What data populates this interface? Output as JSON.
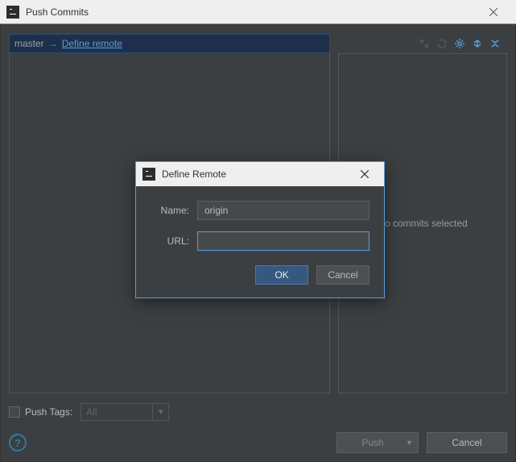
{
  "window": {
    "title": "Push Commits"
  },
  "branch": {
    "local": "master",
    "arrow": "→",
    "remote_link": "Define remote"
  },
  "right": {
    "placeholder": "No commits selected"
  },
  "pushTags": {
    "label": "Push Tags:",
    "comboValue": "All"
  },
  "buttons": {
    "push": "Push",
    "cancel": "Cancel",
    "helpGlyph": "?"
  },
  "modal": {
    "title": "Define Remote",
    "fields": {
      "nameLabel": "Name:",
      "nameValue": "origin",
      "urlLabel": "URL:",
      "urlValue": ""
    },
    "buttons": {
      "ok": "OK",
      "cancel": "Cancel"
    }
  }
}
